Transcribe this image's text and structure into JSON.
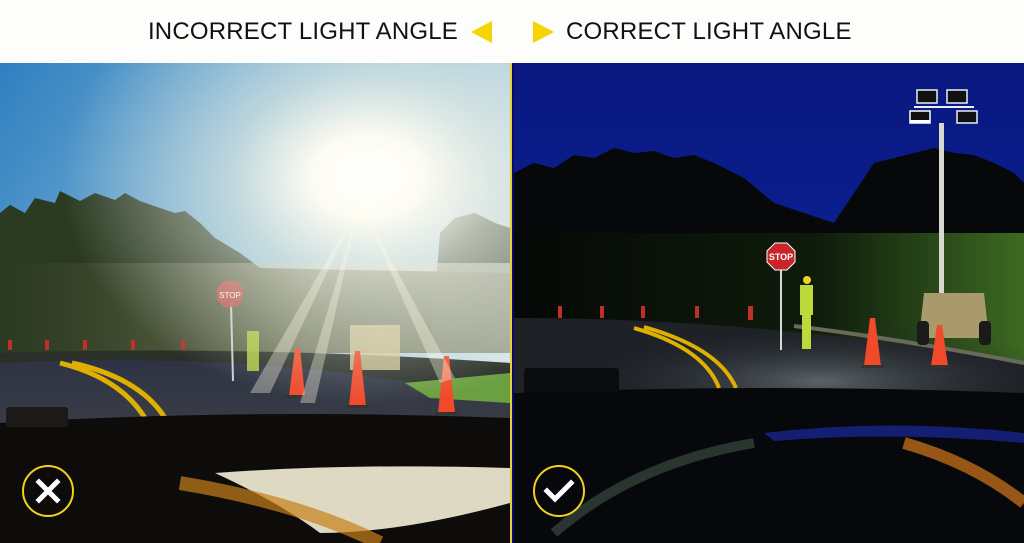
{
  "header": {
    "left_label": "INCORRECT LIGHT ANGLE",
    "right_label": "CORRECT LIGHT ANGLE",
    "left_arrow_icon": "triangle-left-icon",
    "right_arrow_icon": "triangle-right-icon"
  },
  "panels": {
    "left": {
      "description": "Light tower aimed at drivers causing glare",
      "sign_text": "STOP",
      "status_icon": "x-circle-icon"
    },
    "right": {
      "description": "Light tower aimed down at the work zone",
      "sign_text": "STOP",
      "status_icon": "check-circle-icon"
    }
  },
  "colors": {
    "accent_yellow": "#f5d400",
    "badge_ring": "#f2d21a",
    "night_sky": "#0b1a8f",
    "day_sky": "#3d8cc6"
  }
}
